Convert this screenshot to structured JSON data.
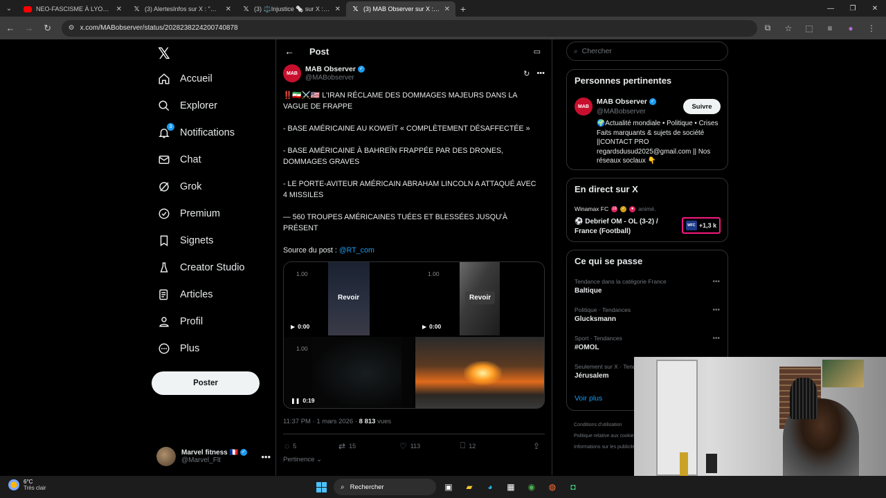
{
  "browser": {
    "tabs": [
      {
        "title": "NEO-FASCISME À LYON: L'E",
        "icon": "youtube-icon",
        "active": false
      },
      {
        "title": "(3) AlertesInfos sur X : \"🚨 usu",
        "icon": "x-icon",
        "active": false
      },
      {
        "title": "(3) ⚖️Injustice 🗞️ sur X : \"FIN D",
        "icon": "x-icon",
        "active": false
      },
      {
        "title": "(3) MAB Observer sur X : \"‼️🇮🇷⚔️",
        "icon": "x-icon",
        "active": true
      }
    ],
    "url": "x.com/MABobserver/status/2028238224200740878"
  },
  "nav": {
    "items": [
      {
        "label": "Accueil",
        "icon": "home-icon"
      },
      {
        "label": "Explorer",
        "icon": "search-icon"
      },
      {
        "label": "Notifications",
        "icon": "bell-icon",
        "badge": "3"
      },
      {
        "label": "Chat",
        "icon": "mail-icon"
      },
      {
        "label": "Grok",
        "icon": "grok-icon"
      },
      {
        "label": "Premium",
        "icon": "verified-badge-icon"
      },
      {
        "label": "Signets",
        "icon": "bookmark-icon"
      },
      {
        "label": "Creator Studio",
        "icon": "creator-studio-icon"
      },
      {
        "label": "Articles",
        "icon": "article-icon"
      },
      {
        "label": "Profil",
        "icon": "person-icon"
      },
      {
        "label": "Plus",
        "icon": "more-circle-icon"
      }
    ],
    "post_button": "Poster",
    "account": {
      "name": "Marvel fitness 🇫🇷",
      "handle": "@Marvel_Flt"
    }
  },
  "post": {
    "header_title": "Post",
    "author": {
      "name": "MAB Observer",
      "handle": "@MABobserver",
      "avatar_text": "MAB"
    },
    "paragraphs": [
      "‼️🇮🇷⚔️🇺🇸 L'IRAN RÉCLAME DES DOMMAGES MAJEURS DANS LA VAGUE DE FRAPPE",
      "- BASE AMÉRICAINE AU KOWEÏT « COMPLÈTEMENT DÉSAFFECTÉE »",
      "- BASE AMÉRICAINE À BAHREÏN FRAPPÉE PAR DES DRONES, DOMMAGES GRAVES",
      "- LE PORTE-AVITEUR AMÉRICAIN ABRAHAM LINCOLN A ATTAQUÉ AVEC 4 MISSILES",
      "— 560 TROUPES AMÉRICAINES TUÉES ET BLESSÉES JUSQU'À PRÉSENT"
    ],
    "source_label": "Source du post : ",
    "source_link": "@RT_com",
    "media": [
      {
        "speed": "1.00",
        "replay": "Revoir",
        "time": "0:00"
      },
      {
        "speed": "1.00",
        "replay": "Revoir",
        "time": "0:00"
      },
      {
        "speed": "1.00",
        "time": "0:19"
      }
    ],
    "time": "11:37 PM · 1 mars 2026 · ",
    "views": "8 813",
    "views_label": " vues",
    "stats": {
      "replies": "5",
      "reposts": "15",
      "likes": "113",
      "bookmarks": "12"
    },
    "sort_label": "Pertinence"
  },
  "right": {
    "search_placeholder": "Chercher",
    "relevant": {
      "title": "Personnes pertinentes",
      "name": "MAB Observer",
      "handle": "@MABobserver",
      "follow": "Suivre",
      "bio": "🌍Actualité mondiale • Politique • Crises Faits marquants & sujets de société ||CONTACT PRO regardsdusud2025@gmail.com || Nos réseaux soclaux 👇"
    },
    "live": {
      "title": "En direct sur X",
      "source": "Winamax FC",
      "source_tag": "animé.",
      "headline": "⚽ Debrief OM - OL (3-2) / France (Football)",
      "count": "+1,3 k",
      "logo_text": "WFC"
    },
    "trends": {
      "title": "Ce qui se passe",
      "items": [
        {
          "category": "Tendance dans la catégorie France",
          "name": "Baltique"
        },
        {
          "category": "Politique · Tendances",
          "name": "Glucksmann"
        },
        {
          "category": "Sport · Tendances",
          "name": "#OMOL"
        },
        {
          "category": "Seulement sur X · Tendances",
          "name": "Jérusalem"
        }
      ],
      "more": "Voir plus"
    },
    "footer": [
      "Conditions d'utilisation",
      "Politique relative aux cookies",
      "Informations sur les publicités"
    ]
  },
  "taskbar": {
    "temp": "6°C",
    "weather": "Très clair",
    "search": "Rechercher"
  }
}
